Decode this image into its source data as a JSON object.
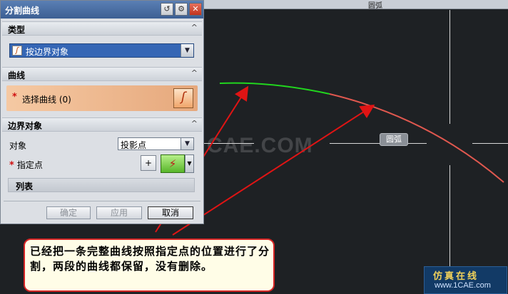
{
  "dialog": {
    "title": "分割曲线",
    "sections": {
      "type": "类型",
      "curve": "曲线",
      "boundary": "边界对象"
    },
    "type_select": {
      "value": "按边界对象",
      "icon": "spline-curve-icon"
    },
    "curve_row": {
      "marker": "*",
      "label": "选择曲线 (0)"
    },
    "object_label": "对象",
    "object_select": {
      "value": "投影点"
    },
    "point_row": {
      "marker": "*",
      "label": "指定点"
    },
    "list_label": "列表",
    "buttons": {
      "ok": "确定",
      "apply": "应用",
      "cancel": "取消"
    },
    "title_icons": [
      "reset-icon",
      "gear-icon",
      "close-icon"
    ],
    "chevron": "^"
  },
  "viewport": {
    "top_label": "圆弧",
    "tag": "圆弧",
    "watermark": "CAE.COM"
  },
  "annotation": {
    "text": "已经把一条完整曲线按照指定点的位置进行了分割，两段的曲线都保留，没有删除。"
  },
  "logo": {
    "line1": "仿真在线",
    "line2": "www.1CAE.com"
  },
  "colors": {
    "curve_segment_1": "#21d61e",
    "curve_segment_2": "#e0584f",
    "arrow": "#e01414",
    "accent": "#3566b5"
  }
}
